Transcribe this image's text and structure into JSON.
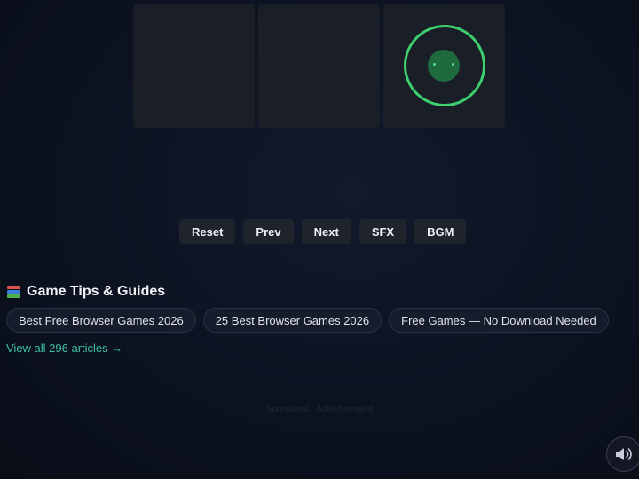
{
  "board": {
    "cells": [
      {
        "state": "empty"
      },
      {
        "state": "empty"
      },
      {
        "state": "player"
      }
    ],
    "player_color": "#3ecf6e"
  },
  "controls": {
    "reset_label": "Reset",
    "prev_label": "Prev",
    "next_label": "Next",
    "sfx_label": "SFX",
    "bgm_label": "BGM"
  },
  "tips": {
    "heading": "Game Tips & Guides",
    "heading_icon": "books-icon",
    "articles": [
      {
        "label": "Best Free Browser Games 2026"
      },
      {
        "label": "25 Best Browser Games 2026"
      },
      {
        "label": "Free Games — No Download Needed"
      }
    ],
    "view_all_label": "View all 296 articles →",
    "link_color": "#3ec1a8"
  },
  "sponsor_label": "Sponsored · Advertisement",
  "sound_toggle_icon": "speaker-icon"
}
